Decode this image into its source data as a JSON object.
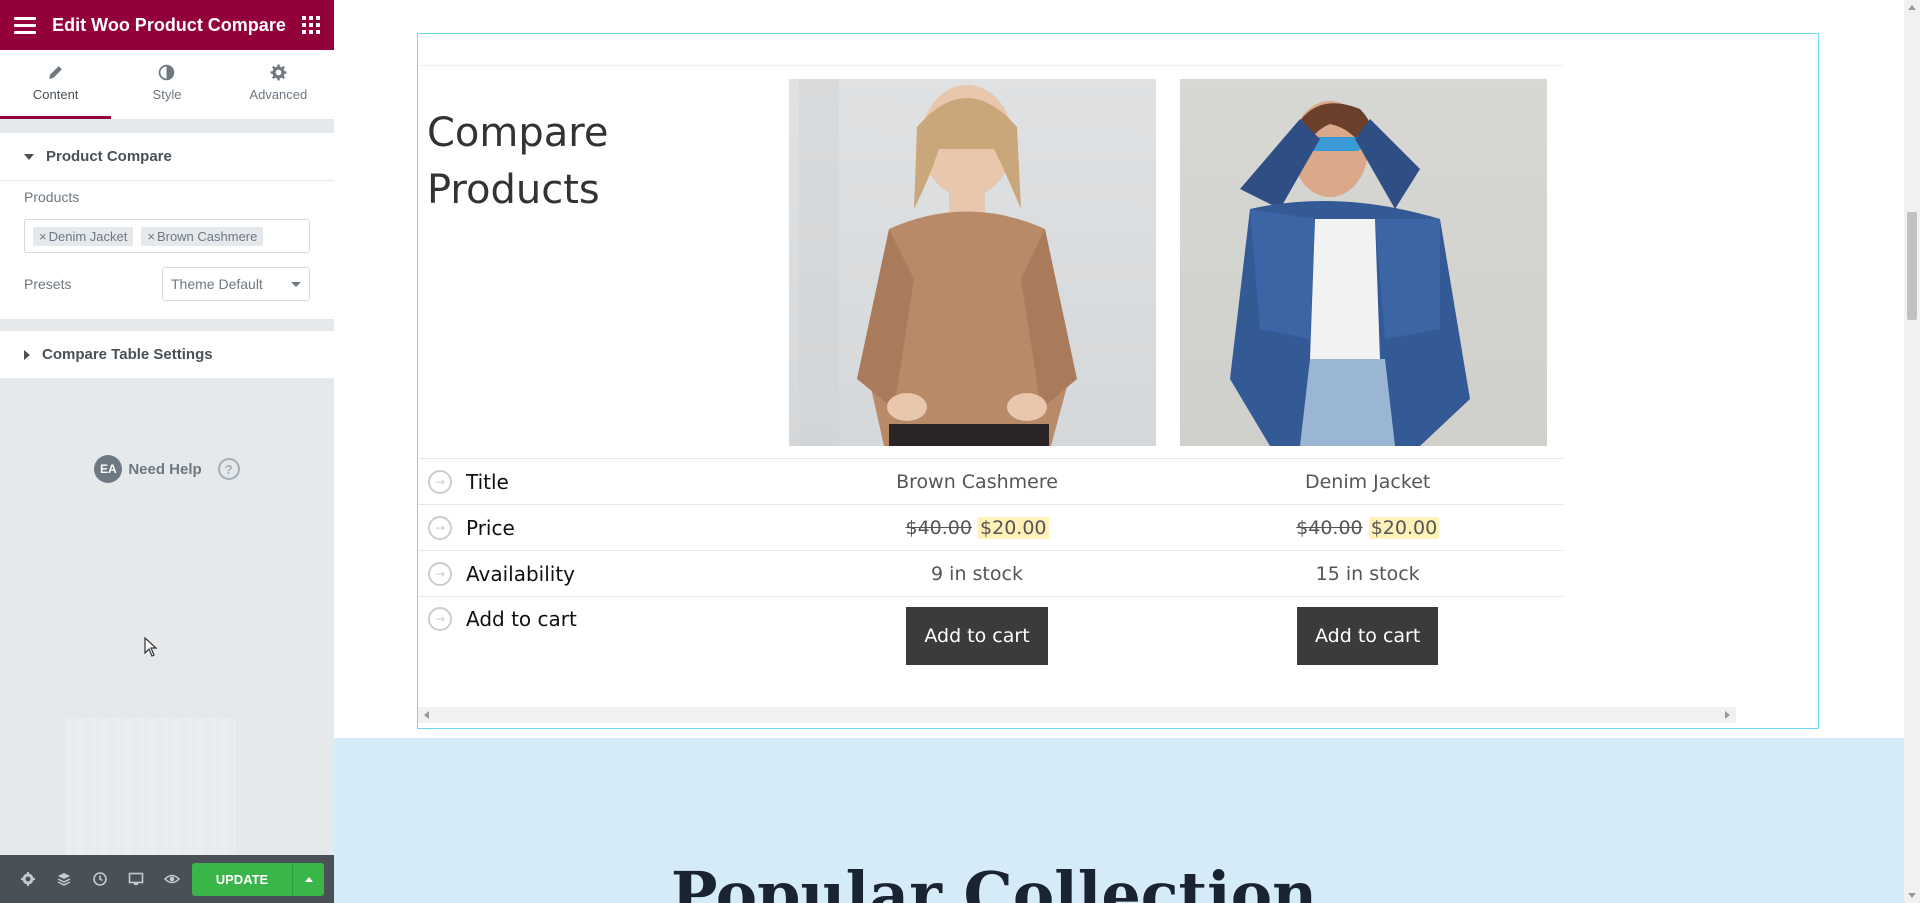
{
  "panel": {
    "header_title": "Edit Woo Product Compare",
    "tabs": [
      {
        "label": "Content",
        "icon": "pencil-icon"
      },
      {
        "label": "Style",
        "icon": "contrast-icon"
      },
      {
        "label": "Advanced",
        "icon": "gear-icon"
      }
    ],
    "section_product_compare": "Product Compare",
    "products_label": "Products",
    "product_tags": [
      "Denim Jacket",
      "Brown Cashmere"
    ],
    "tag_remove_glyph": "×",
    "presets_label": "Presets",
    "presets_value": "Theme Default",
    "section_table_settings": "Compare Table Settings",
    "help_badge": "EA",
    "help_label": "Need Help",
    "help_q": "?",
    "update_label": "UPDATE",
    "collapse_glyph": "‹"
  },
  "compare": {
    "title_line1": "Compare",
    "title_line2": "Products",
    "rows": [
      {
        "label": "Title",
        "col1": "Brown Cashmere",
        "col2": "Denim Jacket"
      },
      {
        "label": "Price",
        "col1_old": "$40.00",
        "col1_new": "$20.00",
        "col2_old": "$40.00",
        "col2_new": "$20.00"
      },
      {
        "label": "Availability",
        "col1": "9 in stock",
        "col2": "15 in stock"
      },
      {
        "label": "Add to cart",
        "col1_button": "Add to cart",
        "col2_button": "Add to cart"
      }
    ]
  },
  "popular": {
    "title": "Popular Collection"
  },
  "colors": {
    "brand": "#93003c",
    "update": "#39b54a",
    "frame": "#71d7f7",
    "section_bg": "#d6ebf8",
    "sale_highlight": "#fff1b8"
  }
}
